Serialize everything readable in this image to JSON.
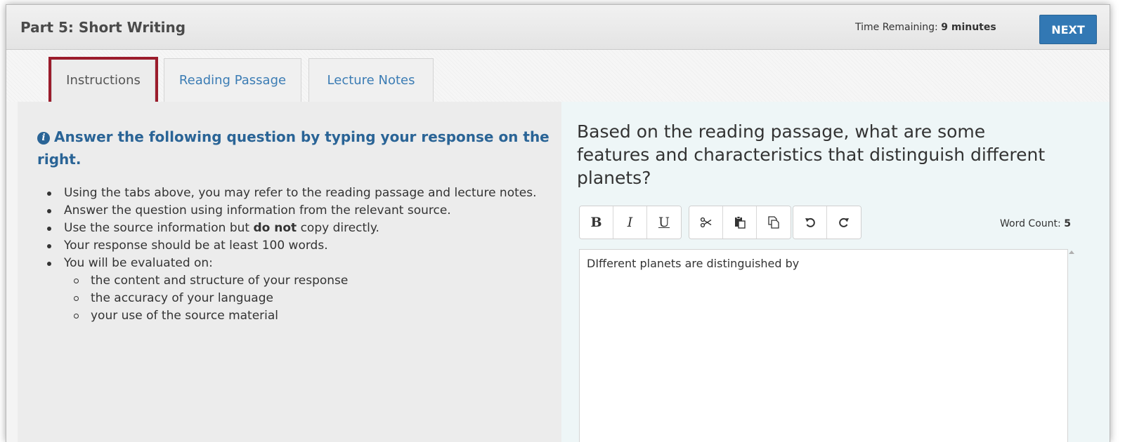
{
  "header": {
    "title": "Part 5: Short Writing",
    "time_label": "Time Remaining:",
    "time_value": "9 minutes",
    "next_label": "NEXT"
  },
  "tabs": [
    {
      "label": "Instructions",
      "active": true
    },
    {
      "label": "Reading Passage",
      "active": false
    },
    {
      "label": "Lecture Notes",
      "active": false
    }
  ],
  "instructions": {
    "heading": "Answer the following question by typing your response on the right.",
    "items": [
      "Using the tabs above, you may refer to the reading passage and lecture notes.",
      "Answer the question using information from the relevant source.",
      {
        "before": "Use the source information but ",
        "bold": "do not",
        "after": " copy directly."
      },
      "Your response should be at least 100 words.",
      "You will be evaluated on:"
    ],
    "sub_items": [
      "the content and structure of your response",
      "the accuracy of your language",
      "your use of the source material"
    ]
  },
  "question": "Based on the reading passage, what are some features and characteristics that distinguish different planets?",
  "editor": {
    "bold_label": "B",
    "italic_label": "I",
    "underline_label": "U",
    "word_count_label": "Word Count:",
    "word_count_value": "5",
    "response_text": "DIfferent planets are distinguished by",
    "icons": [
      "cut-icon",
      "paste-icon",
      "copy-icon",
      "undo-icon",
      "redo-icon",
      "info-icon"
    ]
  },
  "colors": {
    "accent": "#3278b4",
    "heading_blue": "#2a6496",
    "active_tab_outline": "#9b1c2c",
    "right_panel_bg": "#eef6f7",
    "left_panel_bg": "#ececec"
  }
}
